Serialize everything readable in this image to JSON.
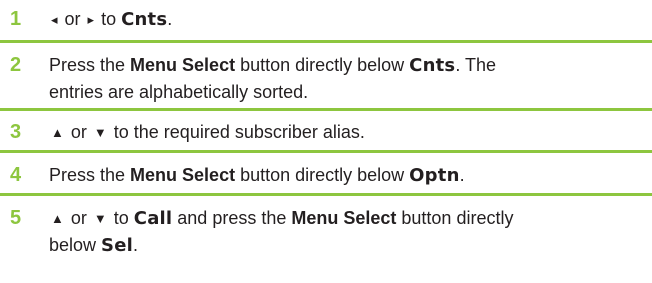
{
  "steps": [
    {
      "number": "1",
      "icon_left": "◂",
      "or": " or ",
      "icon_right": "▸",
      "to": " to ",
      "target": "Cnts",
      "end": "."
    },
    {
      "number": "2",
      "press": "Press the ",
      "button": "Menu Select",
      "mid": " button directly below ",
      "target": "Cnts",
      "line1_end": ". The",
      "line2": "entries are alphabetically sorted."
    },
    {
      "number": "3",
      "icon_up": "▲",
      "or": " or ",
      "icon_down": "▼",
      "rest": " to the required subscriber alias."
    },
    {
      "number": "4",
      "press": "Press the ",
      "button": "Menu Select",
      "mid": " button directly below ",
      "target": "Optn",
      "end": "."
    },
    {
      "number": "5",
      "icon_up": "▲",
      "or": " or ",
      "icon_down": "▼",
      "to": " to ",
      "target": "Call",
      "and": " and press the ",
      "button": "Menu Select",
      "tail": " button directly",
      "line2_pre": "below ",
      "line2_target": "Sel",
      "line2_end": "."
    }
  ],
  "colors": {
    "accent": "#8dc63f",
    "text": "#231f20"
  }
}
